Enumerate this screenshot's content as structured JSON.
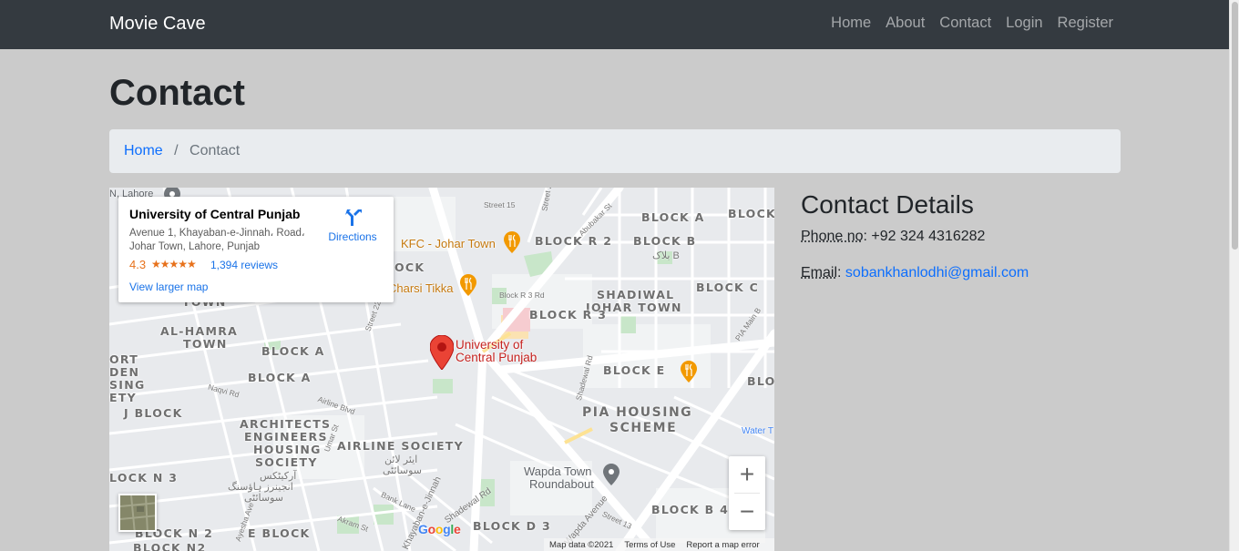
{
  "navbar": {
    "brand": "Movie Cave",
    "links": [
      "Home",
      "About",
      "Contact",
      "Login",
      "Register"
    ]
  },
  "page": {
    "title": "Contact"
  },
  "breadcrumb": {
    "home": "Home",
    "separator": "/",
    "current": "Contact"
  },
  "map": {
    "place_name": "University of Central Punjab",
    "address_line1": "Avenue 1, Khayaban-e-Jinnah، Road،",
    "address_line2": "Johar Town, Lahore, Punjab",
    "rating": "4.3",
    "stars": "★★★★★",
    "reviews": "1,394 reviews",
    "directions": "Directions",
    "view_larger": "View larger map",
    "marker_label_1": "University of",
    "marker_label_2": "Central Punjab",
    "zoom_in": "+",
    "zoom_out": "−",
    "google": [
      "G",
      "o",
      "o",
      "g",
      "l",
      "e"
    ],
    "attribution": [
      "Map data ©2021",
      "Terms of Use",
      "Report a map error"
    ],
    "areas": {
      "block_a_top": "BLOCK A",
      "block_top_right": "BLOCK",
      "block_r2": "BLOCK R 2",
      "block_b": "BLOCK B",
      "block_b_urdu": "بلاک B",
      "ock": "OCK",
      "block_c": "BLOCK C",
      "shadiwal_1": "SHADIWAL",
      "shadiwal_2": "JOHAR TOWN",
      "block_r3": "BLOCK R 3",
      "al_hamra_1": "AL-HAMRA",
      "al_hamra_2": "TOWN",
      "town_left": "TOWN",
      "block_a_mid1": "BLOCK A",
      "block_a_mid2": "BLOCK A",
      "ort_1": "ORT",
      "ort_2": "DEN",
      "ort_3": "SING",
      "ort_4": "ETY",
      "j_block": "J BLOCK",
      "block_e": "BLOCK E",
      "bl_right": "BLO",
      "pia_1": "PIA HOUSING",
      "pia_2": "SCHEME",
      "arch_1": "ARCHITECTS",
      "arch_2": "ENGINEERS",
      "arch_3": "HOUSING",
      "arch_4": "SOCIETY",
      "arch_urdu_1": "آرکیٹکس",
      "arch_urdu_2": "انجینرز ہاؤسنگ",
      "arch_urdu_3": "سوسائٹی",
      "airline": "AIRLINE SOCIETY",
      "airline_urdu_1": "ایئر لائن",
      "airline_urdu_2": "سوسائٹی",
      "lock_n3": "LOCK N 3",
      "block_n2": "BLOCK N 2",
      "block_n2b": "BLOCK N2",
      "e_block": "E BLOCK",
      "block_d3": "BLOCK D 3",
      "block_b4": "BLOCK B 4"
    },
    "pois": {
      "kfc": "KFC - Johar Town",
      "charsi": "Charsi Tikka",
      "wapda_1": "Wapda Town",
      "wapda_2": "Roundabout",
      "water": "Water T"
    },
    "streets": {
      "lahore": "N, Lahore",
      "street15": "Street 15",
      "street2": "Street 2",
      "abubakar": "Abubakar St",
      "block_r3_rd": "Block R 3 Rd",
      "shadewal_rd": "Shadewal Rd",
      "street22": "Street 22",
      "naqvi": "Naqvi Rd",
      "airline_blvd": "Airline Blvd",
      "umar": "Umar St",
      "bank_lane": "Bank Lane",
      "akram": "Akram St",
      "shadewal_rd2": "Shadewal Rd",
      "khayaban": "Khayaban-e-Jinnah",
      "wapda_ave": "Wapda Avenue",
      "pia_main": "PIA Main B",
      "street13": "Street 13",
      "ayesha": "Ayesha Ave"
    }
  },
  "contact": {
    "title": "Contact Details",
    "phone_label": "Phone no",
    "phone_value": "+92 324 4316282",
    "email_label": "Email",
    "email_value": "sobankhanlodhi@gmail.com"
  },
  "colors": {
    "navbar": "#343a40",
    "page_bg": "#cbcbcb",
    "breadcrumb_bg": "#e9ecef",
    "link": "#0d6efd",
    "map_marker": "#ea4335"
  }
}
